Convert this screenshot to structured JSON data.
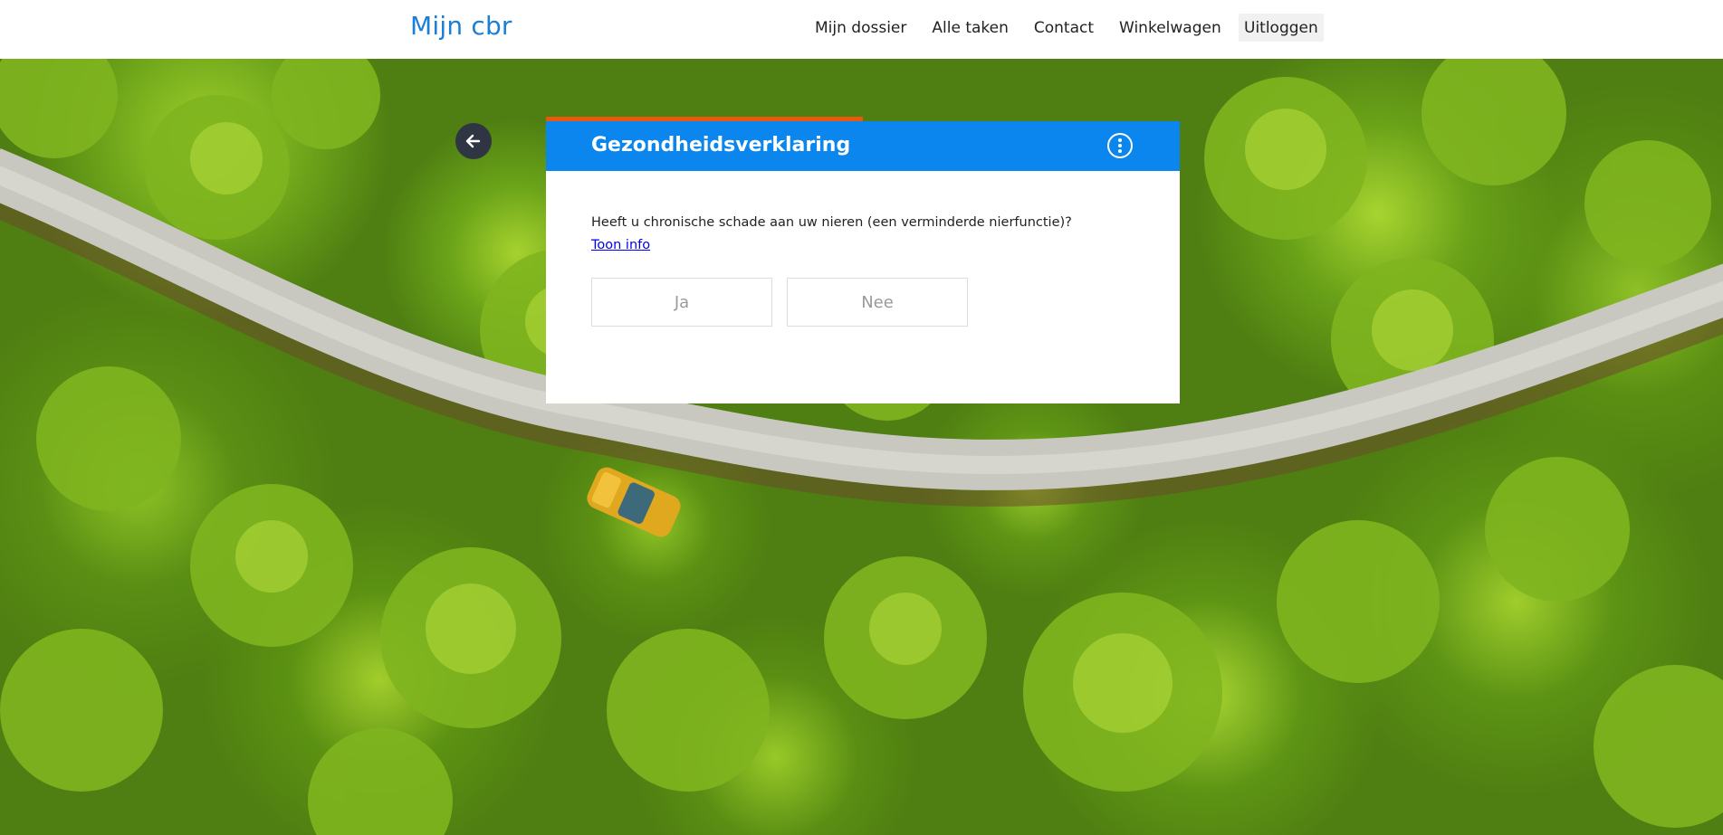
{
  "header": {
    "brand": "Mijn cbr",
    "nav": [
      {
        "label": "Mijn dossier"
      },
      {
        "label": "Alle taken"
      },
      {
        "label": "Contact"
      },
      {
        "label": "Winkelwagen"
      }
    ],
    "logout_label": "Uitloggen"
  },
  "card": {
    "title": "Gezondheidsverklaring",
    "question": "Heeft u chronische schade aan uw nieren (een verminderde nierfunctie)?",
    "info_link": "Toon info",
    "answers": [
      {
        "label": "Ja"
      },
      {
        "label": "Nee"
      }
    ]
  },
  "colors": {
    "brand": "#1a7fd6",
    "card_header": "#0a86ee",
    "progress_accent": "#e8590c"
  },
  "icons": {
    "back": "arrow-left-icon",
    "more": "more-vertical-icon"
  }
}
